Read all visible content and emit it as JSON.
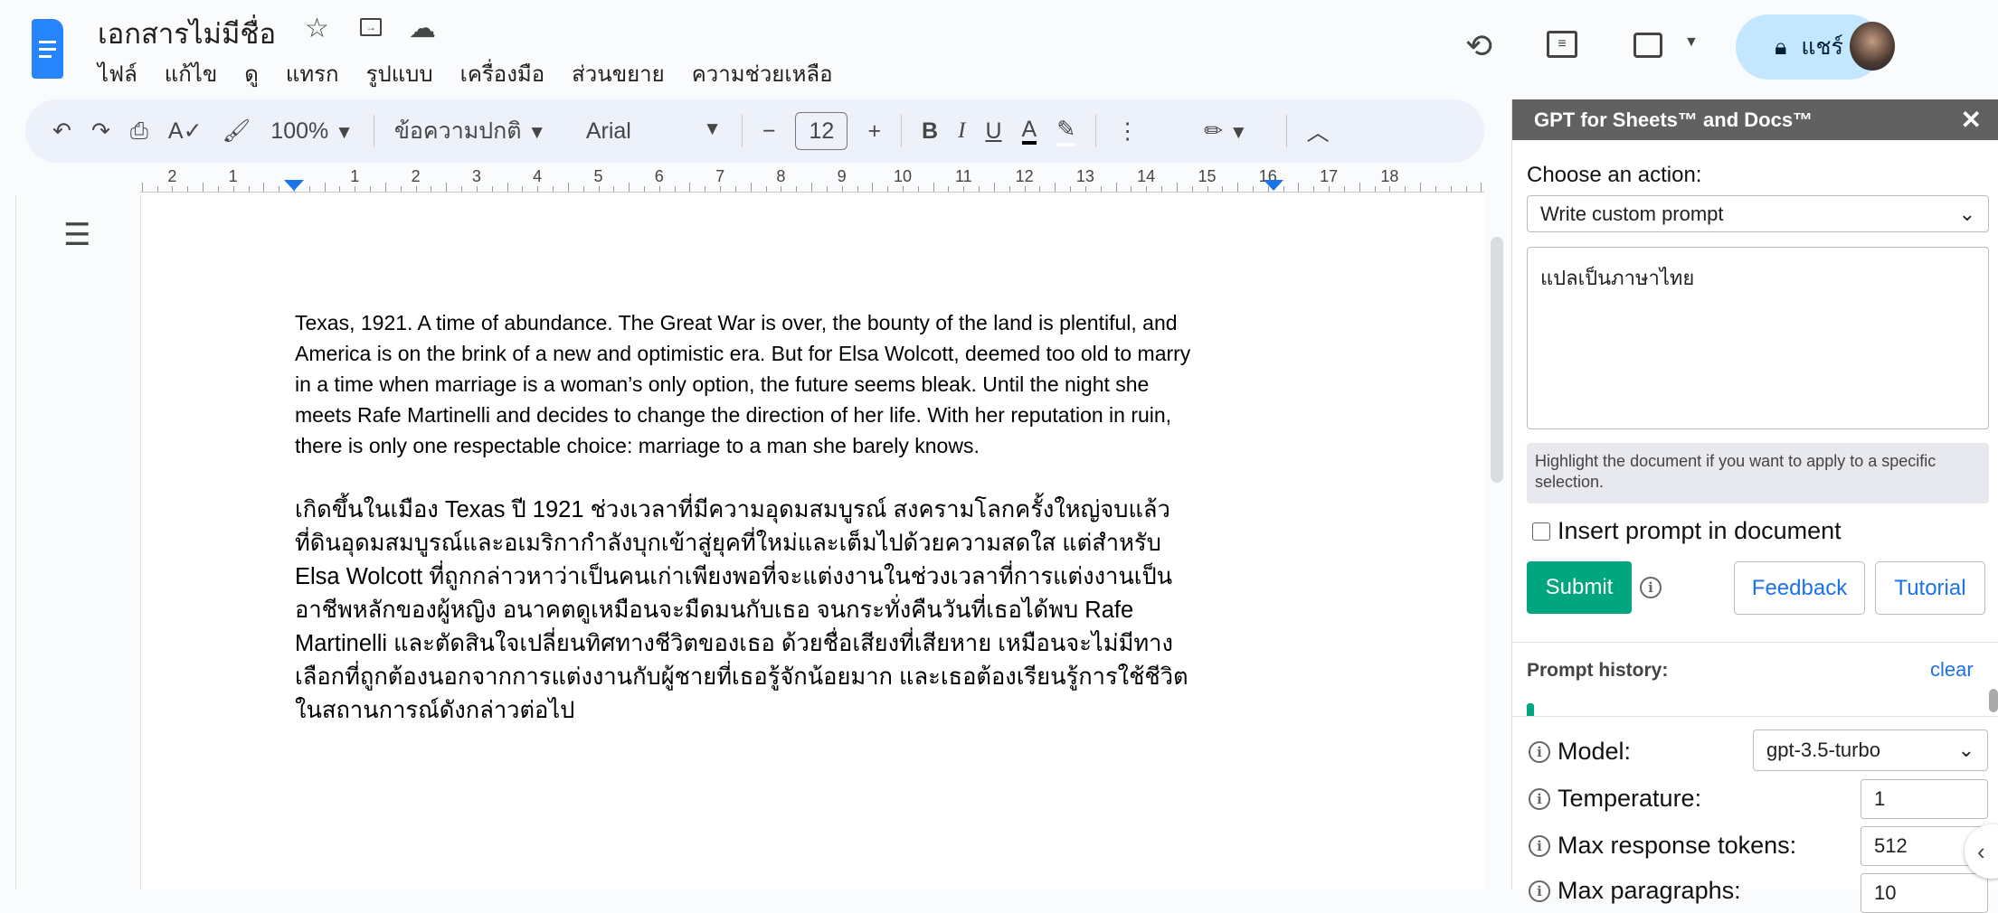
{
  "app": {
    "title": "เอกสารไม่มีชื่อ",
    "menu": [
      "ไฟล์",
      "แก้ไข",
      "ดู",
      "แทรก",
      "รูปแบบ",
      "เครื่องมือ",
      "ส่วนขยาย",
      "ความช่วยเหลือ"
    ],
    "share_label": "แชร์"
  },
  "toolbar": {
    "zoom": "100%",
    "style": "ข้อความปกติ",
    "font": "Arial",
    "font_size": "12"
  },
  "ruler": {
    "numbers": [
      "2",
      "1",
      "1",
      "2",
      "3",
      "4",
      "5",
      "6",
      "7",
      "8",
      "9",
      "10",
      "11",
      "12",
      "13",
      "14",
      "15",
      "16",
      "17",
      "18"
    ]
  },
  "document": {
    "english": "Texas, 1921. A time of abundance. The Great War is over, the bounty of the land is plentiful, and America is on the brink of a new and optimistic era. But for Elsa Wolcott, deemed too old to marry in a time when marriage is a woman’s only option, the future seems bleak. Until the night she meets Rafe Martinelli and decides to change the direction of her life. With her reputation in ruin, there is only one respectable choice: marriage to a man she barely knows.",
    "thai": "เกิดขึ้นในเมือง Texas ปี 1921 ช่วงเวลาที่มีความอุดมสมบูรณ์ สงครามโลกครั้งใหญ่จบแล้ว ที่ดินอุดมสมบูรณ์และอเมริกากำลังบุกเข้าสู่ยุคที่ใหม่และเต็มไปด้วยความสดใส แต่สำหรับ Elsa Wolcott ที่ถูกกล่าวหาว่าเป็นคนเก่าเพียงพอที่จะแต่งงานในช่วงเวลาที่การแต่งงานเป็นอาชีพหลักของผู้หญิง อนาคตดูเหมือนจะมืดมนกับเธอ จนกระทั่งคืนวันที่เธอได้พบ Rafe Martinelli และตัดสินใจเปลี่ยนทิศทางชีวิตของเธอ ด้วยชื่อเสียงที่เสียหาย เหมือนจะไม่มีทางเลือกที่ถูกต้องนอกจากการแต่งงานกับผู้ชายที่เธอรู้จักน้อยมาก และเธอต้องเรียนรู้การใช้ชีวิตในสถานการณ์ดังกล่าวต่อไป"
  },
  "panel": {
    "title": "GPT for Sheets™ and Docs™",
    "choose_label": "Choose an action:",
    "action": "Write custom prompt",
    "prompt": "แปลเป็นภาษาไทย",
    "hint": "Highlight the document if you want to apply to a specific selection.",
    "insert_label": "Insert prompt in document",
    "submit": "Submit",
    "feedback": "Feedback",
    "tutorial": "Tutorial",
    "history_label": "Prompt history:",
    "clear": "clear",
    "model_label": "Model:",
    "model": "gpt-3.5-turbo",
    "temp_label": "Temperature:",
    "temp": "1",
    "tokens_label": "Max response tokens:",
    "tokens": "512",
    "para_label": "Max paragraphs:",
    "para": "10"
  },
  "colors": {
    "accent": "#1a73e8",
    "submit": "#00a67e",
    "panel_header": "#616161",
    "share_bg": "#c2e7ff"
  }
}
